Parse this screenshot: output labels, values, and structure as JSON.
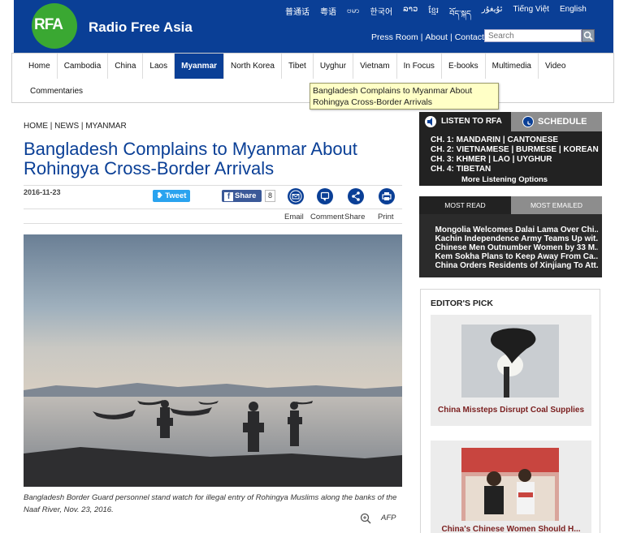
{
  "header": {
    "logo_text": "RFA",
    "site_name": "Radio Free Asia",
    "languages": [
      "普通话",
      "粤语",
      "ဗမာ",
      "한국어",
      "ລາວ",
      "ខ្មែរ",
      "བོད་སྐད",
      "ئۇيغۇر",
      "Tiếng Việt",
      "English"
    ],
    "links": [
      "Press Room",
      "About",
      "Contact"
    ],
    "search_placeholder": "Search",
    "brand_color": "#0a3f96"
  },
  "nav": {
    "row1": [
      "Home",
      "Cambodia",
      "China",
      "Laos",
      "Myanmar",
      "North Korea",
      "Tibet",
      "Uyghur",
      "Vietnam",
      "In Focus",
      "E-books",
      "Multimedia",
      "Video"
    ],
    "row2": [
      "Commentaries"
    ],
    "active": "Myanmar"
  },
  "tooltip": "Bangladesh Complains to Myanmar About Rohingya Cross-Border Arrivals",
  "article": {
    "breadcrumb": [
      "HOME",
      "NEWS",
      "MYANMAR"
    ],
    "headline": "Bangladesh Complains to Myanmar About Rohingya Cross-Border Arrivals",
    "date": "2016-11-23",
    "tweet_label": "Tweet",
    "share_label": "Share",
    "share_count": "8",
    "actions": [
      "Email",
      "Comment",
      "Share",
      "Print"
    ],
    "caption": "Bangladesh Border Guard personnel stand watch for illegal entry of Rohingya Muslims along the banks of the Naaf River, Nov. 23, 2016.",
    "credit": "AFP"
  },
  "listen": {
    "tab_listen": "LISTEN TO RFA",
    "tab_schedule": "SCHEDULE",
    "channels": [
      "CH. 1: MANDARIN | CANTONESE",
      "CH. 2: VIETNAMESE | BURMESE | KOREAN",
      "CH. 3: KHMER | LAO | UYGHUR",
      "CH. 4: TIBETAN"
    ],
    "more": "More Listening Options"
  },
  "most": {
    "tab_read": "MOST READ",
    "tab_emailed": "MOST EMAILED",
    "items": [
      "Mongolia Welcomes Dalai Lama Over Chi...",
      "Kachin Independence Army Teams Up wit...",
      "Chinese Men Outnumber Women by 33 M...",
      "Kem Sokha Plans to Keep Away From Ca...",
      "China Orders Residents of Xinjiang To Att..."
    ]
  },
  "editors_pick": {
    "title": "EDITOR'S PICK",
    "items": [
      "China Missteps Disrupt Coal Supplies",
      "China's Chinese Women Should H..."
    ]
  }
}
